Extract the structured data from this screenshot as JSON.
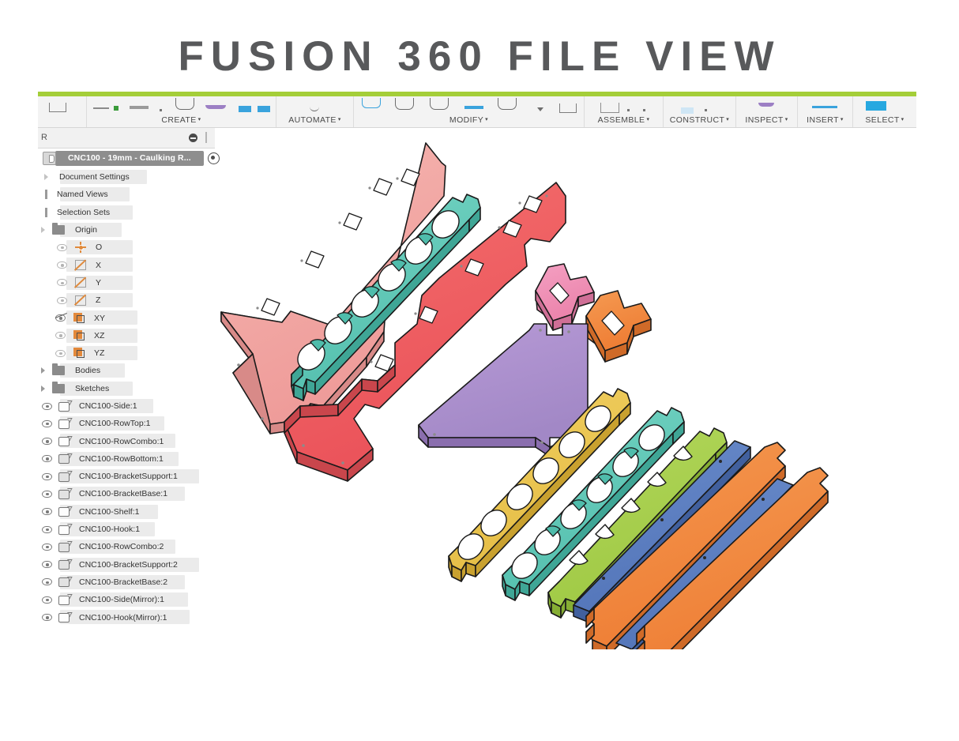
{
  "banner": {
    "title": "FUSION 360 FILE VIEW",
    "accent_color": "#a4ce39",
    "title_color": "#58595b"
  },
  "toolbar": {
    "groups": [
      {
        "label": "CREATE",
        "caret": "▾"
      },
      {
        "label": "AUTOMATE",
        "caret": "▾"
      },
      {
        "label": "MODIFY",
        "caret": "▾"
      },
      {
        "label": "ASSEMBLE",
        "caret": "▾"
      },
      {
        "label": "CONSTRUCT",
        "caret": "▾"
      },
      {
        "label": "INSPECT",
        "caret": "▾"
      },
      {
        "label": "INSERT",
        "caret": "▾"
      },
      {
        "label": "SELECT",
        "caret": "▾"
      }
    ]
  },
  "browser": {
    "title": "R",
    "full_title": "BROWSER",
    "document": {
      "label": "CNC100 - 19mm - Caulking R...",
      "selected": true,
      "selection_color": "#8e8e8e"
    },
    "items": [
      {
        "label": "Document Settings",
        "type": "group",
        "indent": 0
      },
      {
        "label": "Named Views",
        "type": "group-plain",
        "indent": 0
      },
      {
        "label": "Selection Sets",
        "type": "group-plain",
        "indent": 0
      },
      {
        "label": "Origin",
        "type": "folder",
        "indent": 0
      }
    ],
    "origin_items": [
      {
        "label": "O",
        "icon": "origin-point-icon",
        "visible": true
      },
      {
        "label": "X",
        "icon": "axis-icon",
        "visible": true
      },
      {
        "label": "Y",
        "icon": "axis-icon",
        "visible": true
      },
      {
        "label": "Z",
        "icon": "axis-icon",
        "visible": true
      },
      {
        "label": "XY",
        "icon": "plane-icon",
        "visible": false
      },
      {
        "label": "XZ",
        "icon": "plane-icon",
        "visible": true
      },
      {
        "label": "YZ",
        "icon": "plane-icon",
        "visible": true
      }
    ],
    "folders": [
      {
        "label": "Bodies"
      },
      {
        "label": "Sketches"
      }
    ],
    "components": [
      {
        "label": "CNC100-Side:1"
      },
      {
        "label": "CNC100-RowTop:1"
      },
      {
        "label": "CNC100-RowCombo:1"
      },
      {
        "label": "CNC100-RowBottom:1"
      },
      {
        "label": "CNC100-BracketSupport:1"
      },
      {
        "label": "CNC100-BracketBase:1"
      },
      {
        "label": "CNC100-Shelf:1"
      },
      {
        "label": "CNC100-Hook:1"
      },
      {
        "label": "CNC100-RowCombo:2"
      },
      {
        "label": "CNC100-BracketSupport:2"
      },
      {
        "label": "CNC100-BracketBase:2"
      },
      {
        "label": "CNC100-Side(Mirror):1"
      },
      {
        "label": "CNC100-Hook(Mirror):1"
      }
    ]
  },
  "canvas": {
    "view": "exploded-isometric",
    "parts": [
      {
        "name": "CNC100-Side(Mirror):1",
        "color": "#f0a09d"
      },
      {
        "name": "CNC100-RowTop:1",
        "color": "#5fc8b8"
      },
      {
        "name": "CNC100-Side:1",
        "color": "#ef5e62"
      },
      {
        "name": "CNC100-Hook(Mirror):1",
        "color": "#ef8fb4"
      },
      {
        "name": "CNC100-Hook:1",
        "color": "#f0a24a"
      },
      {
        "name": "CNC100-Shelf:1",
        "color": "#ac92cd"
      },
      {
        "name": "CNC100-RowCombo:1",
        "color": "#ecc54f"
      },
      {
        "name": "CNC100-RowCombo:2",
        "color": "#5fc8b8"
      },
      {
        "name": "CNC100-RowBottom:1",
        "color": "#a8cf4f"
      },
      {
        "name": "CNC100-BracketSupport:1",
        "color": "#5b7ec2"
      },
      {
        "name": "CNC100-BracketSupport:2",
        "color": "#5b7ec2"
      },
      {
        "name": "CNC100-BracketBase:1",
        "color": "#f1883f"
      },
      {
        "name": "CNC100-BracketBase:2",
        "color": "#f1883f"
      }
    ]
  }
}
